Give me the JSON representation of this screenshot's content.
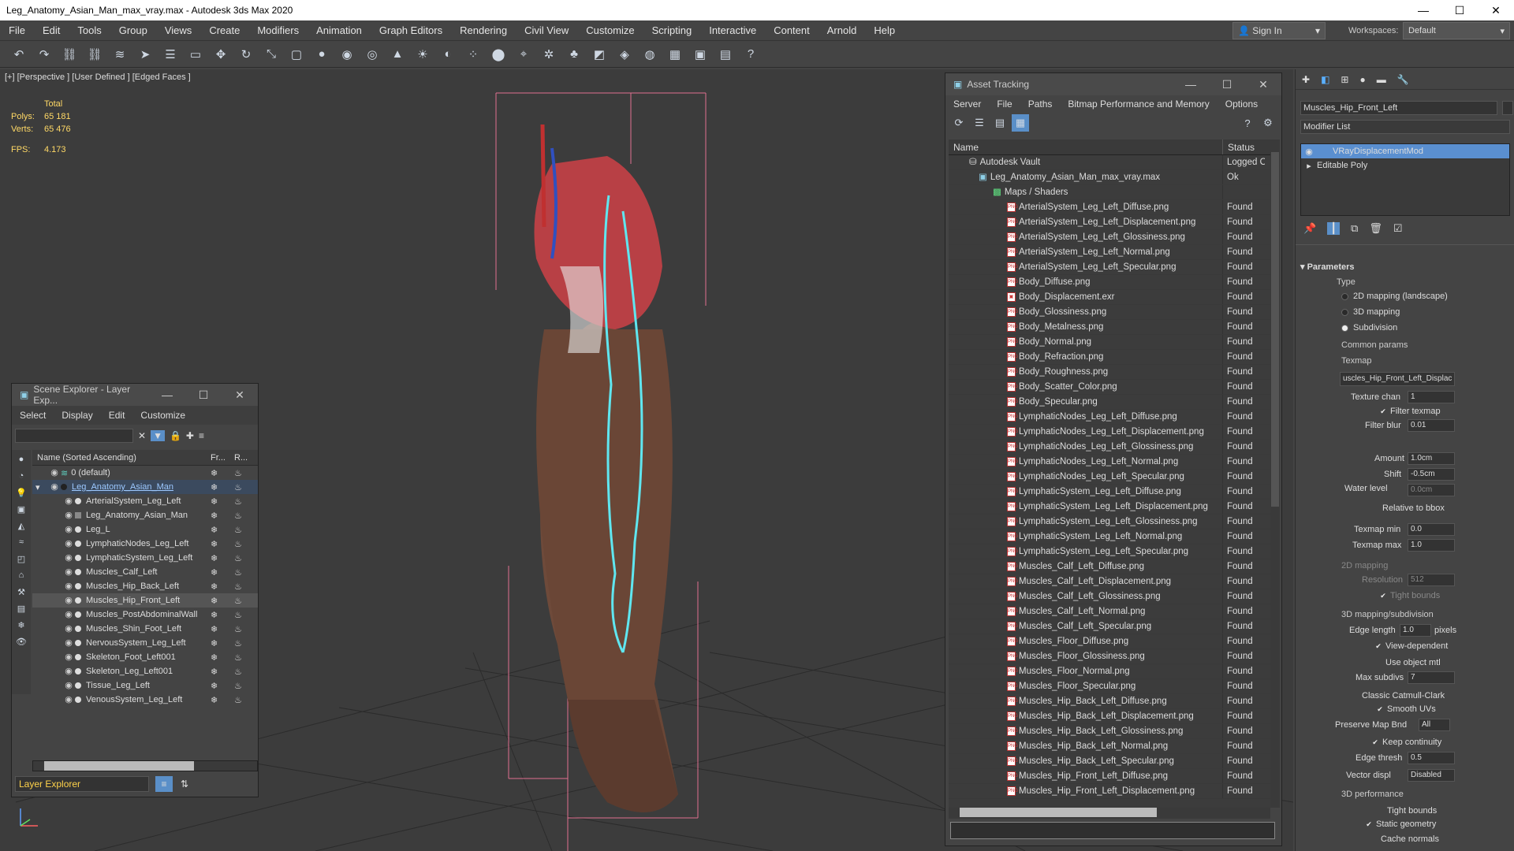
{
  "window": {
    "title": "Leg_Anatomy_Asian_Man_max_vray.max - Autodesk 3ds Max 2020",
    "min": "—",
    "max": "☐",
    "close": "✕"
  },
  "menu": [
    "File",
    "Edit",
    "Tools",
    "Group",
    "Views",
    "Create",
    "Modifiers",
    "Animation",
    "Graph Editors",
    "Rendering",
    "Civil View",
    "Customize",
    "Scripting",
    "Interactive",
    "Content",
    "Arnold",
    "Help"
  ],
  "account": {
    "signin": "Sign In",
    "workspaces_label": "Workspaces:",
    "workspace": "Default"
  },
  "viewport": {
    "label": "[+] [Perspective ] [User Defined ] [Edged Faces ]",
    "stats": {
      "total": "Total",
      "polys_label": "Polys:",
      "polys": "65 181",
      "verts_label": "Verts:",
      "verts": "65 476",
      "fps_label": "FPS:",
      "fps": "4.173"
    }
  },
  "scene_explorer": {
    "title": "Scene Explorer - Layer Exp...",
    "menu": [
      "Select",
      "Display",
      "Edit",
      "Customize"
    ],
    "col_name": "Name (Sorted Ascending)",
    "col_fr": "Fr...",
    "col_r": "R...",
    "layers": [
      {
        "name": "0 (default)",
        "level": 1
      },
      {
        "name": "Leg_Anatomy_Asian_Man",
        "level": 1
      },
      {
        "name": "ArterialSystem_Leg_Left",
        "level": 2
      },
      {
        "name": "Leg_Anatomy_Asian_Man",
        "level": 2
      },
      {
        "name": "Leg_L",
        "level": 2
      },
      {
        "name": "LymphaticNodes_Leg_Left",
        "level": 2
      },
      {
        "name": "LymphaticSystem_Leg_Left",
        "level": 2
      },
      {
        "name": "Muscles_Calf_Left",
        "level": 2
      },
      {
        "name": "Muscles_Hip_Back_Left",
        "level": 2
      },
      {
        "name": "Muscles_Hip_Front_Left",
        "level": 2
      },
      {
        "name": "Muscles_PostAbdominalWall",
        "level": 2
      },
      {
        "name": "Muscles_Shin_Foot_Left",
        "level": 2
      },
      {
        "name": "NervousSystem_Leg_Left",
        "level": 2
      },
      {
        "name": "Skeleton_Foot_Left001",
        "level": 2
      },
      {
        "name": "Skeleton_Leg_Left001",
        "level": 2
      },
      {
        "name": "Tissue_Leg_Left",
        "level": 2
      },
      {
        "name": "VenousSystem_Leg_Left",
        "level": 2
      }
    ],
    "footer": "Layer Explorer"
  },
  "asset_tracking": {
    "title": "Asset Tracking",
    "menu": [
      "Server",
      "File",
      "Paths",
      "Bitmap Performance and Memory",
      "Options"
    ],
    "col_name": "Name",
    "col_status": "Status",
    "vault": {
      "name": "Autodesk Vault",
      "status": "Logged O"
    },
    "file": {
      "name": "Leg_Anatomy_Asian_Man_max_vray.max",
      "status": "Ok"
    },
    "group": "Maps / Shaders",
    "maps": [
      "ArterialSystem_Leg_Left_Diffuse.png",
      "ArterialSystem_Leg_Left_Displacement.png",
      "ArterialSystem_Leg_Left_Glossiness.png",
      "ArterialSystem_Leg_Left_Normal.png",
      "ArterialSystem_Leg_Left_Specular.png",
      "Body_Diffuse.png",
      "Body_Displacement.exr",
      "Body_Glossiness.png",
      "Body_Metalness.png",
      "Body_Normal.png",
      "Body_Refraction.png",
      "Body_Roughness.png",
      "Body_Scatter_Color.png",
      "Body_Specular.png",
      "LymphaticNodes_Leg_Left_Diffuse.png",
      "LymphaticNodes_Leg_Left_Displacement.png",
      "LymphaticNodes_Leg_Left_Glossiness.png",
      "LymphaticNodes_Leg_Left_Normal.png",
      "LymphaticNodes_Leg_Left_Specular.png",
      "LymphaticSystem_Leg_Left_Diffuse.png",
      "LymphaticSystem_Leg_Left_Displacement.png",
      "LymphaticSystem_Leg_Left_Glossiness.png",
      "LymphaticSystem_Leg_Left_Normal.png",
      "LymphaticSystem_Leg_Left_Specular.png",
      "Muscles_Calf_Left_Diffuse.png",
      "Muscles_Calf_Left_Displacement.png",
      "Muscles_Calf_Left_Glossiness.png",
      "Muscles_Calf_Left_Normal.png",
      "Muscles_Calf_Left_Specular.png",
      "Muscles_Floor_Diffuse.png",
      "Muscles_Floor_Glossiness.png",
      "Muscles_Floor_Normal.png",
      "Muscles_Floor_Specular.png",
      "Muscles_Hip_Back_Left_Diffuse.png",
      "Muscles_Hip_Back_Left_Displacement.png",
      "Muscles_Hip_Back_Left_Glossiness.png",
      "Muscles_Hip_Back_Left_Normal.png",
      "Muscles_Hip_Back_Left_Specular.png",
      "Muscles_Hip_Front_Left_Diffuse.png",
      "Muscles_Hip_Front_Left_Displacement.png"
    ],
    "found": "Found"
  },
  "command_panel": {
    "object_name": "Muscles_Hip_Front_Left",
    "modifier_list": "Modifier List",
    "stack": [
      "VRayDisplacementMod",
      "Editable Poly"
    ],
    "rollout": "Parameters",
    "type_label": "Type",
    "types": [
      "2D mapping (landscape)",
      "3D mapping",
      "Subdivision"
    ],
    "common": "Common params",
    "texmap": "Texmap",
    "texmap_value": "uscles_Hip_Front_Left_Displac",
    "texture_chan": "Texture chan",
    "texture_chan_v": "1",
    "filter_texmap": "Filter texmap",
    "filter_blur": "Filter blur",
    "filter_blur_v": "0.01",
    "amount": "Amount",
    "amount_v": "1.0cm",
    "shift": "Shift",
    "shift_v": "-0.5cm",
    "water": "Water level",
    "water_v": "0.0cm",
    "rel_bbox": "Relative to bbox",
    "tmin": "Texmap min",
    "tmin_v": "0.0",
    "tmax": "Texmap max",
    "tmax_v": "1.0",
    "map2d": "2D mapping",
    "resolution": "Resolution",
    "resolution_v": "512",
    "tight": "Tight bounds",
    "map3d": "3D mapping/subdivision",
    "edge_len": "Edge length",
    "edge_len_v": "1.0",
    "pixels": "pixels",
    "view_dep": "View-dependent",
    "use_obj": "Use object mtl",
    "max_subdivs": "Max subdivs",
    "max_subdivs_v": "7",
    "catmull": "Classic Catmull-Clark",
    "smooth": "Smooth UVs",
    "preserve": "Preserve Map Bnd",
    "preserve_v": "All",
    "keep": "Keep continuity",
    "edge_thresh": "Edge thresh",
    "edge_thresh_v": "0.5",
    "vector": "Vector displ",
    "vector_v": "Disabled",
    "perf": "3D performance",
    "tight2": "Tight bounds",
    "static": "Static geometry",
    "cache": "Cache normals"
  }
}
